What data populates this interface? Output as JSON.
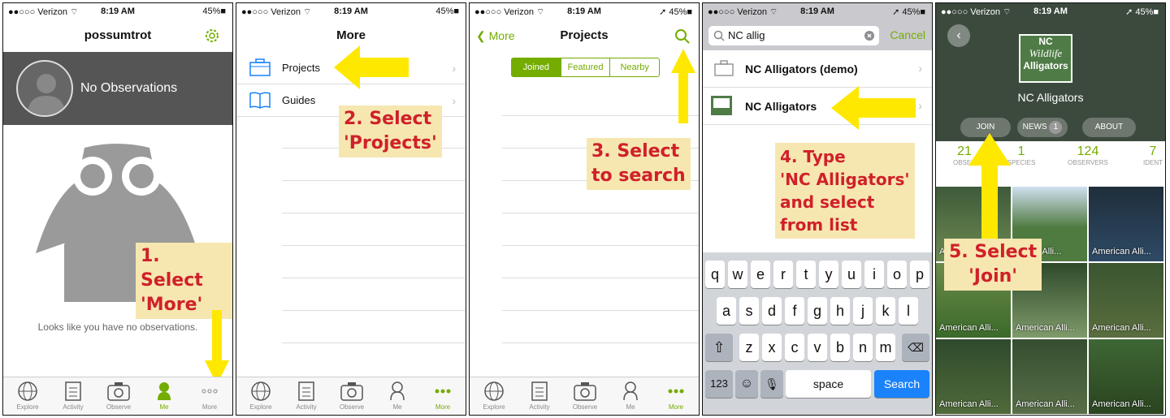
{
  "status": {
    "carrier": "●●○○○ Verizon ⌔",
    "time": "8:19 AM",
    "battery_a": "45%■",
    "battery_b": "➚ 45%■"
  },
  "tabs": [
    "Explore",
    "Activity",
    "Observe",
    "Me",
    "More"
  ],
  "panel1": {
    "title": "possumtrot",
    "no_observations": "No Observations",
    "empty_message": "Looks like you have no observations."
  },
  "panel2": {
    "title": "More",
    "items": [
      {
        "label": "Projects"
      },
      {
        "label": "Guides"
      }
    ]
  },
  "panel3": {
    "title": "Projects",
    "back": "❮ More",
    "segments": [
      "Joined",
      "Featured",
      "Nearby"
    ]
  },
  "panel4": {
    "search_value": "NC allig",
    "cancel": "Cancel",
    "results": [
      {
        "label": "NC Alligators (demo)"
      },
      {
        "label": "NC Alligators"
      }
    ],
    "keys_row1": [
      "q",
      "w",
      "e",
      "r",
      "t",
      "y",
      "u",
      "i",
      "o",
      "p"
    ],
    "keys_row2": [
      "a",
      "s",
      "d",
      "f",
      "g",
      "h",
      "j",
      "k",
      "l"
    ],
    "keys_row3": [
      "z",
      "x",
      "c",
      "v",
      "b",
      "n",
      "m"
    ],
    "key_123": "123",
    "key_space": "space",
    "key_search": "Search"
  },
  "panel5": {
    "logo_line1": "NC",
    "logo_line2": "Wildlife",
    "logo_line3": "Alligators",
    "title": "NC Alligators",
    "join": "JOIN",
    "news": "NEWS",
    "news_count": "1",
    "about": "ABOUT",
    "stats": [
      {
        "n": "21",
        "l": "OBSER"
      },
      {
        "n": "1",
        "l": "SPECIES"
      },
      {
        "n": "124",
        "l": "OBSERVERS"
      },
      {
        "n": "7",
        "l": "IDENT"
      }
    ],
    "tile_caption": "American Alli...",
    "tile_caption_short": "erican Alli...",
    "tile_caption_a": "A"
  },
  "callouts": {
    "c1": [
      "1. Select",
      "'More'"
    ],
    "c2": [
      "2. Select",
      "'Projects'"
    ],
    "c3": [
      "3. Select",
      "to search"
    ],
    "c4": [
      "4. Type",
      "'NC Alligators'",
      " and select",
      " from list"
    ],
    "c5": [
      "5. Select",
      "'Join'"
    ]
  },
  "colors": {
    "accent": "#74ac00",
    "callout_text": "#d0202a",
    "callout_bg": "#f6e7b0",
    "arrow": "#ffe800"
  }
}
